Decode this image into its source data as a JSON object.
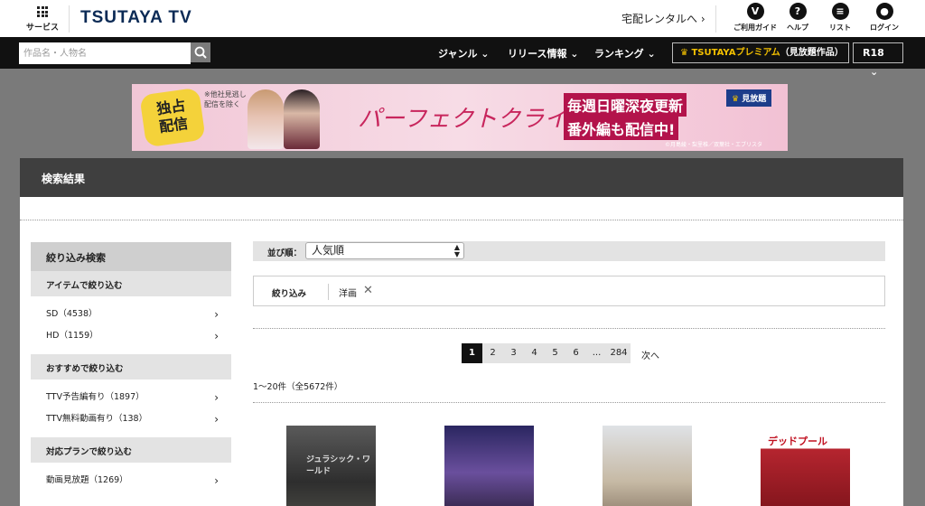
{
  "header": {
    "service_label": "サービス",
    "logo": "TSUTAYA TV",
    "delivery_link": "宅配レンタルへ",
    "icons": [
      {
        "icon": "v-icon",
        "glyph": "V",
        "label": "ご利用ガイド"
      },
      {
        "icon": "help-icon",
        "glyph": "?",
        "label": "ヘルプ"
      },
      {
        "icon": "list-icon",
        "glyph": "≡",
        "label": "リスト"
      },
      {
        "icon": "user-icon",
        "glyph": "●",
        "label": "ログイン"
      }
    ]
  },
  "nav": {
    "search_placeholder": "作品名・人物名",
    "genre": "ジャンル",
    "release": "リリース情報",
    "ranking": "ランキング",
    "premium_brand": "TSUTAYAプレミアム",
    "premium_suffix": "（見放題作品）",
    "r18": "R18"
  },
  "banner": {
    "badge_line1": "独占",
    "badge_line2": "配信",
    "note_line1": "※他社見逃し",
    "note_line2": "配信を除く",
    "title": "パーフェクトクライム",
    "text1": "毎週日曜深夜更新",
    "text2": "番外編も配信中!",
    "mihodai": "見放題",
    "copyright": "©月島綾・梨里椎／双葉社・エブリスタ"
  },
  "results": {
    "heading": "検索結果",
    "sort_label": "並び順：",
    "sort_value": "人気順",
    "filter_label": "絞り込み",
    "filter_tag": "洋画",
    "count_text": "1〜20件（全5672件）",
    "pages": [
      "1",
      "2",
      "3",
      "4",
      "5",
      "6",
      "...",
      "284"
    ],
    "next": "次へ"
  },
  "sidebar": {
    "title": "絞り込み検索",
    "sections": [
      {
        "heading": "アイテムで絞り込む",
        "items": [
          "SD（4538）",
          "HD（1159）"
        ]
      },
      {
        "heading": "おすすめで絞り込む",
        "items": [
          "TTV予告編有り（1897）",
          "TTV無料動画有り（138）"
        ]
      },
      {
        "heading": "対応プランで絞り込む",
        "items": [
          "動画見放題（1269）"
        ]
      }
    ]
  },
  "posters": [
    {
      "text": "ジュラシック・ワールド"
    },
    {
      "text": ""
    },
    {
      "text": ""
    },
    {
      "text": "デッドプール"
    }
  ]
}
